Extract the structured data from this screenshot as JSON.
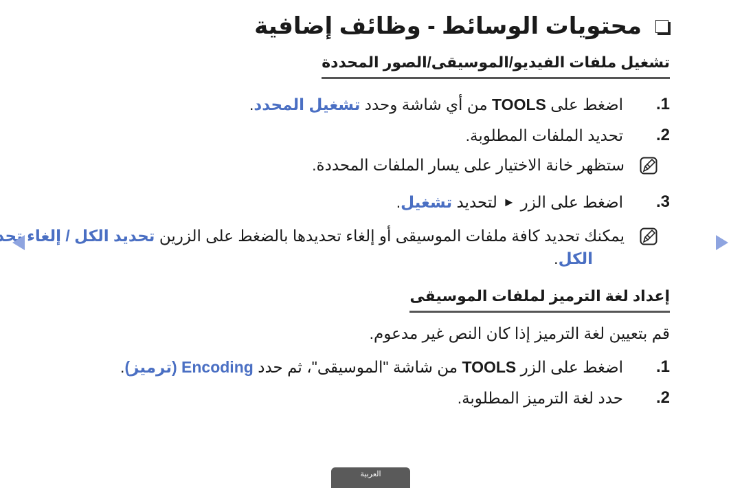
{
  "title": "محتويات الوسائط - وظائف إضافية",
  "section1": {
    "heading": "تشغيل ملفات الفيديو/الموسيقى/الصور المحددة",
    "steps": [
      {
        "num": "1.",
        "pre": "اضغط على",
        "key": "TOOLS",
        "mid": "من أي شاشة وحدد",
        "link": "تشغيل المحدد",
        "post": "."
      },
      {
        "num": "2.",
        "text": "تحديد الملفات المطلوبة."
      },
      {
        "num": "3.",
        "pre": "اضغط على الزر",
        "symbol": "►",
        "mid": "لتحديد",
        "link": "تشغيل",
        "post": "."
      }
    ],
    "note1": "ستظهر خانة الاختيار على يسار الملفات المحددة.",
    "note2": {
      "text": "يمكنك تحديد كافة ملفات الموسيقى أو إلغاء تحديدها بالضغط على الزرين",
      "link1": "تحديد الكل",
      "sep": "/",
      "link2": "إلغاء تحديد",
      "link2_cont": "الكل",
      "post": "."
    }
  },
  "section2": {
    "heading": "إعداد لغة الترميز لملفات الموسيقى",
    "intro": "قم بتعيين لغة الترميز إذا كان النص غير مدعوم.",
    "steps": [
      {
        "num": "1.",
        "pre": "اضغط على الزر",
        "key": "TOOLS",
        "mid": "من شاشة \"الموسيقى\"، ثم حدد",
        "link": "Encoding (ترميز)",
        "post": "."
      },
      {
        "num": "2.",
        "text": "حدد لغة الترميز المطلوبة."
      }
    ]
  },
  "nav": {
    "prev_icon": "arrow-left-icon",
    "next_icon": "arrow-right-icon"
  },
  "footer": {
    "language_tab": "العربية"
  },
  "colors": {
    "accent_blue": "#4a6fc3",
    "arrow_blue": "#8ea4e0",
    "tab_gray": "#5a5a5a"
  }
}
